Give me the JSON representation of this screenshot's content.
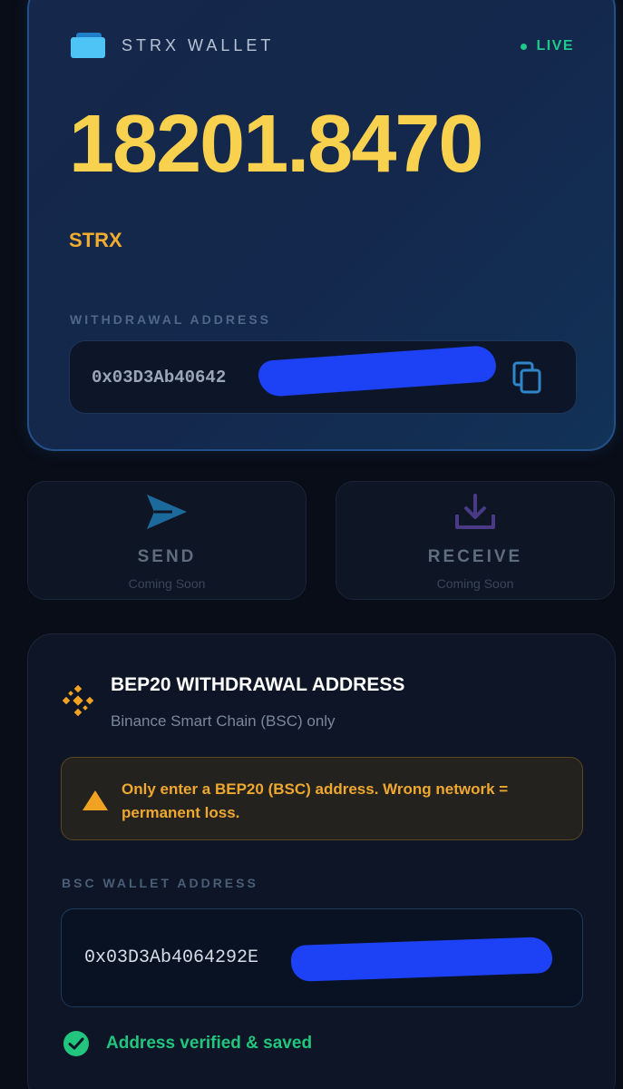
{
  "wallet": {
    "title": "STRX WALLET",
    "status": "LIVE",
    "balance": "18201.8470",
    "unit": "STRX",
    "withdrawal_label": "WITHDRAWAL ADDRESS",
    "address_visible": "0x03D3Ab40642"
  },
  "actions": {
    "send": {
      "label": "SEND",
      "sub": "Coming Soon"
    },
    "receive": {
      "label": "RECEIVE",
      "sub": "Coming Soon"
    }
  },
  "bep20": {
    "title": "BEP20 WITHDRAWAL ADDRESS",
    "subtitle": "Binance Smart Chain (BSC) only",
    "warning": "Only enter a BEP20 (BSC) address. Wrong network = permanent loss.",
    "bsc_label": "BSC WALLET ADDRESS",
    "bsc_address_visible": "0x03D3Ab4064292E",
    "verified": "Address verified & saved"
  },
  "colors": {
    "accent_gold": "#f8d24f",
    "unit_orange": "#f2ad2e",
    "live_green": "#1ec98a",
    "warn_orange": "#eea830",
    "redaction_blue": "#1d42f5"
  }
}
